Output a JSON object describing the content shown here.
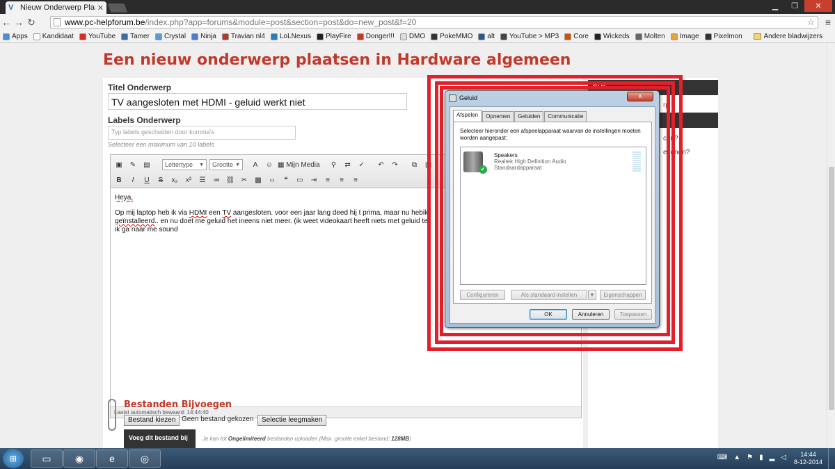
{
  "browser": {
    "tab_title": "Nieuw Onderwerp Plaatse",
    "tab_favicon": "V",
    "url_host": "www.pc-helpforum.be",
    "url_path": "/index.php?app=forums&module=post&section=post&do=new_post&f=20",
    "bookmarks": [
      {
        "label": "Apps",
        "color": "#4a8fd8"
      },
      {
        "label": "Kandidaat",
        "color": "#ffffff"
      },
      {
        "label": "YouTube",
        "color": "#d62d20"
      },
      {
        "label": "Tamer",
        "color": "#3b6ea5"
      },
      {
        "label": "Crystal",
        "color": "#5b9bd5"
      },
      {
        "label": "Ninja",
        "color": "#4f7dd1"
      },
      {
        "label": "Travian nl4",
        "color": "#b33a2a"
      },
      {
        "label": "LoLNexus",
        "color": "#2a7fb8"
      },
      {
        "label": "PlayFire",
        "color": "#222222"
      },
      {
        "label": "Donger!!!",
        "color": "#c0392b"
      },
      {
        "label": "DMO",
        "color": "#dddddd"
      },
      {
        "label": "PokeMMO",
        "color": "#333333"
      },
      {
        "label": "alt",
        "color": "#2b5797"
      },
      {
        "label": "YouTube > MP3",
        "color": "#444444"
      },
      {
        "label": "Core",
        "color": "#d35400"
      },
      {
        "label": "Wickeds",
        "color": "#222222"
      },
      {
        "label": "Molten",
        "color": "#666666"
      },
      {
        "label": "Image",
        "color": "#e5a437"
      },
      {
        "label": "Pixelmon",
        "color": "#333333"
      }
    ],
    "other_bookmarks": "Andere bladwijzers"
  },
  "page": {
    "title": "Een nieuw onderwerp plaatsen in Hardware algemeen",
    "title_label": "Titel Onderwerp",
    "title_value": "TV aangesloten met HDMI - geluid werkt niet",
    "labels_label": "Labels Onderwerp",
    "labels_placeholder": "Typ labels gescheiden door komma's",
    "labels_hint": "Selecteer een maximum van 10 labels",
    "editor": {
      "font_combo": "Lettertype",
      "size_combo": "Grootte",
      "media_label": "Mijn Media",
      "toolbar_row2": [
        "B",
        "I",
        "U",
        "S",
        "x₂",
        "x²"
      ],
      "body_greeting": "Heya,",
      "body_line1_a": "Op mij laptop heb ik via ",
      "body_line1_b": "HDMI",
      "body_line1_c": " een ",
      "body_line1_d": "TV",
      "body_line1_e": " aangesloten. voor een jaar lang deed hij t prima, maar nu h",
      "body_line1_f": "ebik",
      "body_line2_a": "geïnstalleerd",
      "body_line2_b": ".. en nu doet me geluid het ineens niet meer. (ik weet videokaart heeft niets met gel",
      "body_line2_c": "uid te",
      "body_line3": "ik ga naar me sound",
      "status": "Laatst automatisch bewaard: 14:44:40"
    },
    "attach": {
      "title": "Bestanden Bijvoegen",
      "choose_btn": "Bestand kiezen",
      "no_file": "Geen bestand gekozen",
      "clear_btn": "Selectie leegmaken",
      "add_btn": "Voeg dit bestand bij",
      "info_a": "Je kan tot ",
      "info_b": "Ongelimiteerd",
      "info_c": " bestanden uploaden (Max. grootte enkel bestand: ",
      "info_d": "128MB",
      "info_e": ")"
    },
    "sidebar": {
      "bar1": "Poll",
      "link1": "rp",
      "link2": "con?",
      "link3": "ekenen?"
    }
  },
  "dialog": {
    "title": "Geluid",
    "close": "x",
    "tabs": [
      "Afspelen",
      "Opnemen",
      "Geluiden",
      "Communicatie"
    ],
    "description": "Selecteer hieronder een afspeelapparaat waarvan de instellingen moeten worden aangepast:",
    "device_name": "Speakers",
    "device_driver": "Realtek High Definition Audio",
    "device_status": "Standaardapparaat",
    "btn_configure": "Configureren",
    "btn_default": "Als standaard instellen",
    "btn_properties": "Eigenschappen",
    "btn_ok": "OK",
    "btn_cancel": "Annuleren",
    "btn_apply": "Toepassen"
  },
  "taskbar": {
    "time": "14:44",
    "date": "8-12-2014"
  }
}
